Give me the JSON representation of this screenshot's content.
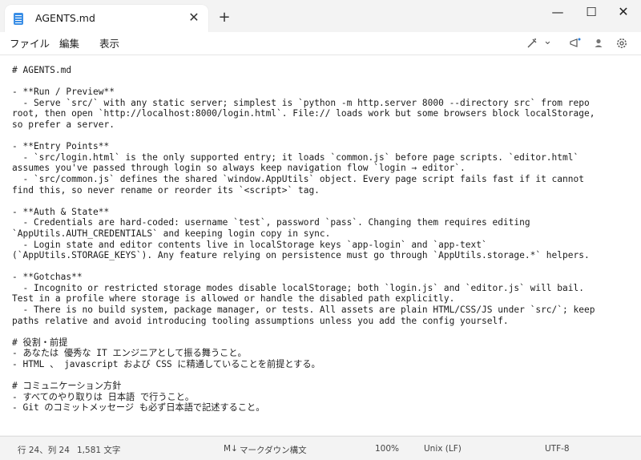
{
  "tab": {
    "title": "AGENTS.md",
    "close": "✕",
    "new": "+"
  },
  "window": {
    "minimize": "—",
    "maximize": "☐",
    "close": "✕"
  },
  "menu": {
    "file": "ファイル",
    "edit": "編集",
    "view": "表示"
  },
  "toolbar": {
    "chevron": "⌄"
  },
  "editor": {
    "lines": [
      "# AGENTS.md",
      "",
      "- **Run / Preview**",
      "  - Serve `src/` with any static server; simplest is `python -m http.server 8000 --directory src` from repo",
      "root, then open `http://localhost:8000/login.html`. File:// loads work but some browsers block localStorage,",
      "so prefer a server.",
      "",
      "- **Entry Points**",
      "  - `src/login.html` is the only supported entry; it loads `common.js` before page scripts. `editor.html`",
      "assumes you've passed through login so always keep navigation flow `login → editor`.",
      "  - `src/common.js` defines the shared `window.AppUtils` object. Every page script fails fast if it cannot",
      "find this, so never rename or reorder its `<script>` tag.",
      "",
      "- **Auth & State**",
      "  - Credentials are hard-coded: username `test`, password `pass`. Changing them requires editing",
      "`AppUtils.AUTH_CREDENTIALS` and keeping login copy in sync.",
      "  - Login state and editor contents live in localStorage keys `app-login` and `app-text`",
      "(`AppUtils.STORAGE_KEYS`). Any feature relying on persistence must go through `AppUtils.storage.*` helpers.",
      "",
      "- **Gotchas**",
      "  - Incognito or restricted storage modes disable localStorage; both `login.js` and `editor.js` will bail.",
      "Test in a profile where storage is allowed or handle the disabled path explicitly.",
      "  - There is no build system, package manager, or tests. All assets are plain HTML/CSS/JS under `src/`; keep",
      "paths relative and avoid introducing tooling assumptions unless you add the config yourself.",
      "",
      "# 役割・前提",
      "- あなたは 優秀な IT エンジニアとして振る舞うこと。",
      "- HTML 、 javascript および CSS に精通していることを前提とする。",
      "",
      "# コミュニケーション方針",
      "- すべてのやり取りは 日本語 で行うこと。",
      "- Git のコミットメッセージ も必ず日本語で記述すること。"
    ]
  },
  "status": {
    "position": "行 24、列 24",
    "chars": "1,581 文字",
    "md_badge": "M↓",
    "mode": "マークダウン構文",
    "zoom": "100%",
    "eol": "Unix (LF)",
    "encoding": "UTF-8"
  }
}
